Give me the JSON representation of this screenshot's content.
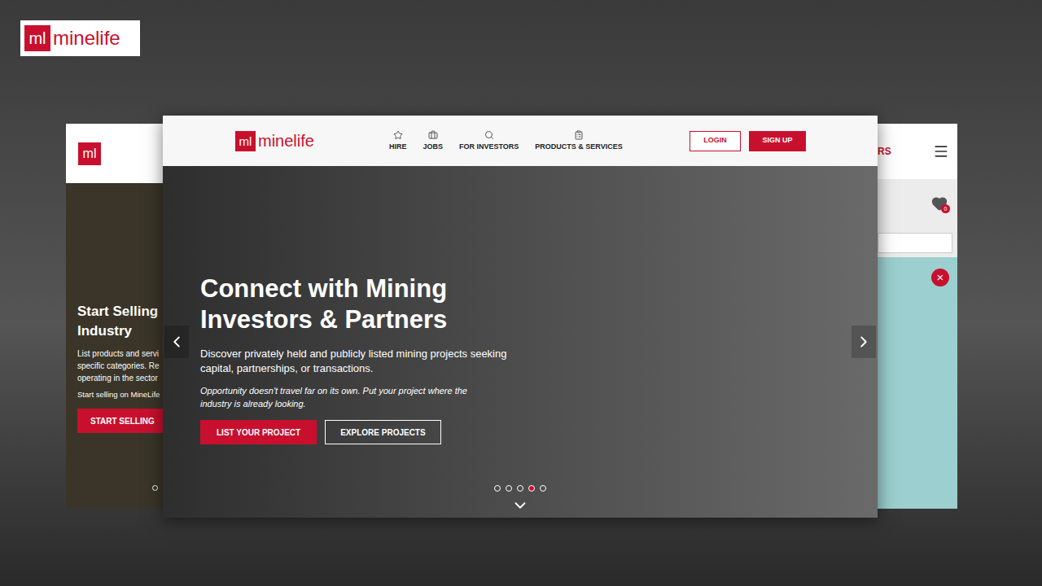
{
  "corner_logo": {
    "mark": "ml",
    "name": "minelife"
  },
  "left_window": {
    "logo_mark": "ml",
    "title_lines": [
      "Start Selling",
      "Industry"
    ],
    "body_lines": [
      "List products and servi",
      "specific categories. Re",
      "operating in the sector"
    ],
    "link": "Start selling on MineLife",
    "button": "START SELLING",
    "dots": [
      {
        "selected": false
      }
    ]
  },
  "main_window": {
    "logo": {
      "mark": "ml",
      "name": "minelife"
    },
    "nav": [
      {
        "label": "HIRE",
        "icon": "star"
      },
      {
        "label": "JOBS",
        "icon": "briefcase"
      },
      {
        "label": "FOR INVESTORS",
        "icon": "search"
      },
      {
        "label": "PRODUCTS & SERVICES",
        "icon": "clipboard"
      }
    ],
    "login": "LOGIN",
    "signup": "SIGN UP",
    "hero": {
      "title_lines": [
        "Connect with Mining",
        "Investors & Partners"
      ],
      "body_lines": [
        "Discover privately held and publicly listed mining projects seeking",
        "capital, partnerships, or transactions."
      ],
      "tagline_lines": [
        "Opportunity doesn't travel far on its own. Put your project where the",
        "industry is already looking."
      ],
      "primary_button": "LIST YOUR PROJECT",
      "secondary_button": "EXPLORE PROJECTS"
    },
    "slides": [
      {
        "selected": false
      },
      {
        "selected": false
      },
      {
        "selected": false
      },
      {
        "selected": true
      },
      {
        "selected": false
      }
    ]
  },
  "right_window": {
    "header_text": "RS",
    "favorites_count": "0",
    "map_close": "×"
  }
}
